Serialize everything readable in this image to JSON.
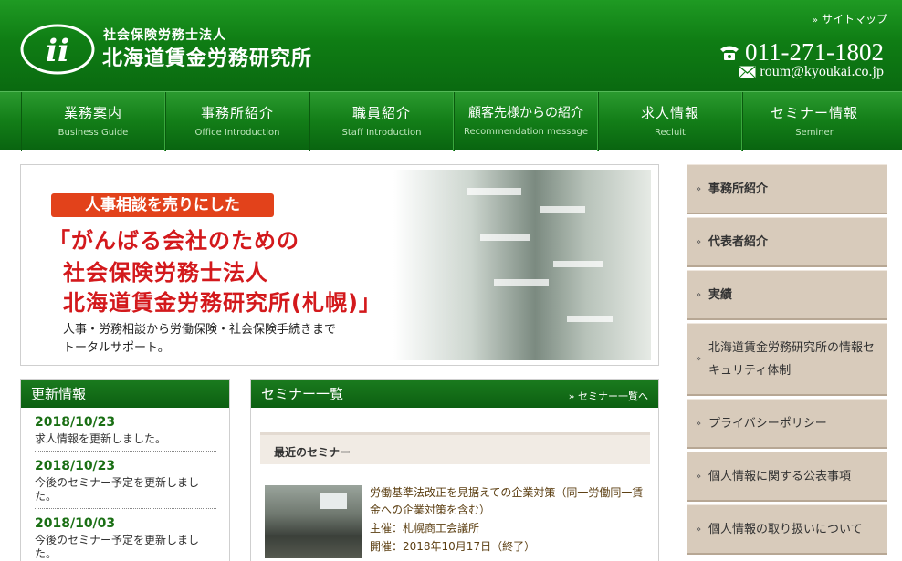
{
  "header": {
    "logo_sub": "社会保険労務士法人",
    "logo_main": "北海道賃金労務研究所",
    "sitemap": "サイトマップ",
    "phone": "011-271-1802",
    "email": "roum@kyoukai.co.jp"
  },
  "nav": [
    {
      "jp": "業務案内",
      "en": "Business Guide"
    },
    {
      "jp": "事務所紹介",
      "en": "Office Introduction"
    },
    {
      "jp": "職員紹介",
      "en": "Staff Introduction"
    },
    {
      "jp": "顧客先様からの紹介",
      "en": "Recommendation message"
    },
    {
      "jp": "求人情報",
      "en": "Recluit"
    },
    {
      "jp": "セミナー情報",
      "en": "Seminer"
    }
  ],
  "hero": {
    "badge": "人事相談を売りにした",
    "title_1": "「がんばる会社のための",
    "title_2": "社会保険労務士法人",
    "title_3": "北海道賃金労務研究所(札幌)」",
    "sub_1": "人事・労務相談から労働保険・社会保険手続きまで",
    "sub_2": "トータルサポート。"
  },
  "updates": {
    "heading": "更新情報",
    "items": [
      {
        "date": "2018/10/23",
        "text": "求人情報を更新しました。"
      },
      {
        "date": "2018/10/23",
        "text": "今後のセミナー予定を更新しました。"
      },
      {
        "date": "2018/10/03",
        "text": "今後のセミナー予定を更新しました。"
      }
    ]
  },
  "seminar": {
    "heading": "セミナー一覧",
    "more": "セミナー一覧へ",
    "recent": "最近のセミナー",
    "item": {
      "title": "労働基準法改正を見据えての企業対策（同一労働同一賃金への企業対策を含む）",
      "host": "主催：札幌商工会議所",
      "date": "開催：2018年10月17日（終了）"
    }
  },
  "sidebar": [
    {
      "label": "事務所紹介",
      "bold": true
    },
    {
      "label": "代表者紹介",
      "bold": true
    },
    {
      "label": "実績",
      "bold": true
    },
    {
      "label": "北海道賃金労務研究所の情報セキュリティ体制",
      "bold": false
    },
    {
      "label": "プライバシーポリシー",
      "bold": false
    },
    {
      "label": "個人情報に関する公表事項",
      "bold": false
    },
    {
      "label": "個人情報の取り扱いについて",
      "bold": false
    }
  ]
}
